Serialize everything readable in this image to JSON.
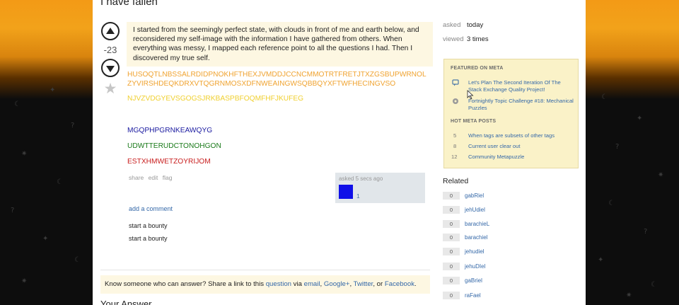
{
  "question": {
    "title": "I have fallen",
    "vote_count": "-23",
    "body": "I started from the seemingly perfect state, with clouds in front of me and earth below, and reconsidered my self-image with the information I have gathered from others. When everything was messy, I mapped each reference point to all the questions I had. Then I discovered my true self.",
    "spam_lines": [
      {
        "text": "HUSOQTLNBSSALRDIDPNOKHFTHEXJVMDDJCCNCMMOTRTFRETJTXZGSBUPWRNOLZYVIRSHDEQKDRXVTQGRNMOSXDFNWEAINGWSQBBQYXFTWFHECINGVSO",
        "color": "#f0a330"
      },
      {
        "text": "NJVZVDGYEVSGOGSJRKBASPBFOQMFHFJKUFEG",
        "color": "#f0d030"
      },
      {
        "text": "MGQPHPGRNKEAWQYG",
        "color": "#1a1aa0"
      },
      {
        "text": "UDWTTERUDCTONOHGON",
        "color": "#1a7a1a"
      },
      {
        "text": "ESTXHMWETZOYRIJOM",
        "color": "#c81e1e"
      }
    ],
    "menu": [
      "share",
      "edit",
      "flag"
    ],
    "user_card": {
      "asked": "asked 5 secs ago",
      "reputation": "1",
      "avatar_color": "#1010e8"
    },
    "add_comment": "add a comment",
    "bounties": [
      "start a bounty",
      "start a bounty"
    ]
  },
  "share_box": {
    "prefix": "Know someone who can answer? Share a link to this ",
    "question_link": "question",
    "via": " via ",
    "email": "email",
    "sep1": ", ",
    "google": "Google+",
    "sep2": ", ",
    "twitter": "Twitter",
    "or": ", or ",
    "facebook": "Facebook",
    "end": "."
  },
  "your_answer": "Your Answer",
  "meta": {
    "asked_label": "asked",
    "asked_value": "today",
    "viewed_label": "viewed",
    "viewed_value": "3 times"
  },
  "featured": {
    "header": "FEATURED ON META",
    "items": [
      {
        "label": "Let's Plan The Second Iteration Of The Stack Exchange Quality Project!",
        "icon": "chat-bubble-icon"
      },
      {
        "label": "Fortnightly Topic Challenge #18: Mechanical Puzzles",
        "icon": "puzzle-icon"
      }
    ],
    "hot_header": "HOT META POSTS",
    "hot": [
      {
        "count": "5",
        "label": "When tags are subsets of other tags"
      },
      {
        "count": "8",
        "label": "Current user clear out"
      },
      {
        "count": "12",
        "label": "Community Metapuzzle"
      }
    ]
  },
  "related": {
    "title": "Related",
    "items": [
      {
        "score": "0",
        "label": "gabRiel"
      },
      {
        "score": "0",
        "label": "jehUdiel"
      },
      {
        "score": "0",
        "label": "barachieL"
      },
      {
        "score": "0",
        "label": "barachiel"
      },
      {
        "score": "0",
        "label": "jehudiel"
      },
      {
        "score": "0",
        "label": "jehuDIel"
      },
      {
        "score": "0",
        "label": "gaBriel"
      },
      {
        "score": "0",
        "label": "raFael"
      }
    ]
  },
  "colors": {
    "link": "#3468a8",
    "accent_bg": "#fdf7e2",
    "sidebar_bg": "#faf2c8"
  }
}
